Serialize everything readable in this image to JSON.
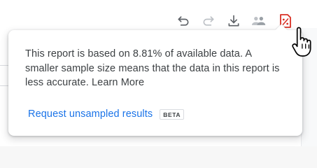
{
  "toolbar": {
    "items": [
      {
        "name": "undo-icon"
      },
      {
        "name": "redo-icon"
      },
      {
        "name": "download-icon"
      },
      {
        "name": "share-users-icon"
      },
      {
        "name": "data-quality-icon"
      }
    ],
    "quality_icon_color": "#d93025",
    "icon_color": "#5f6368"
  },
  "sampling_popup": {
    "message": "This report is based on 8.81% of available data. A smaller sample size means that the data in this report is less accurate.",
    "learn_more_label": "Learn More",
    "request_link_label": "Request unsampled results",
    "badge_label": "BETA",
    "link_color": "#1a73e8"
  },
  "cursor": {
    "type": "hand-pointer-icon"
  }
}
